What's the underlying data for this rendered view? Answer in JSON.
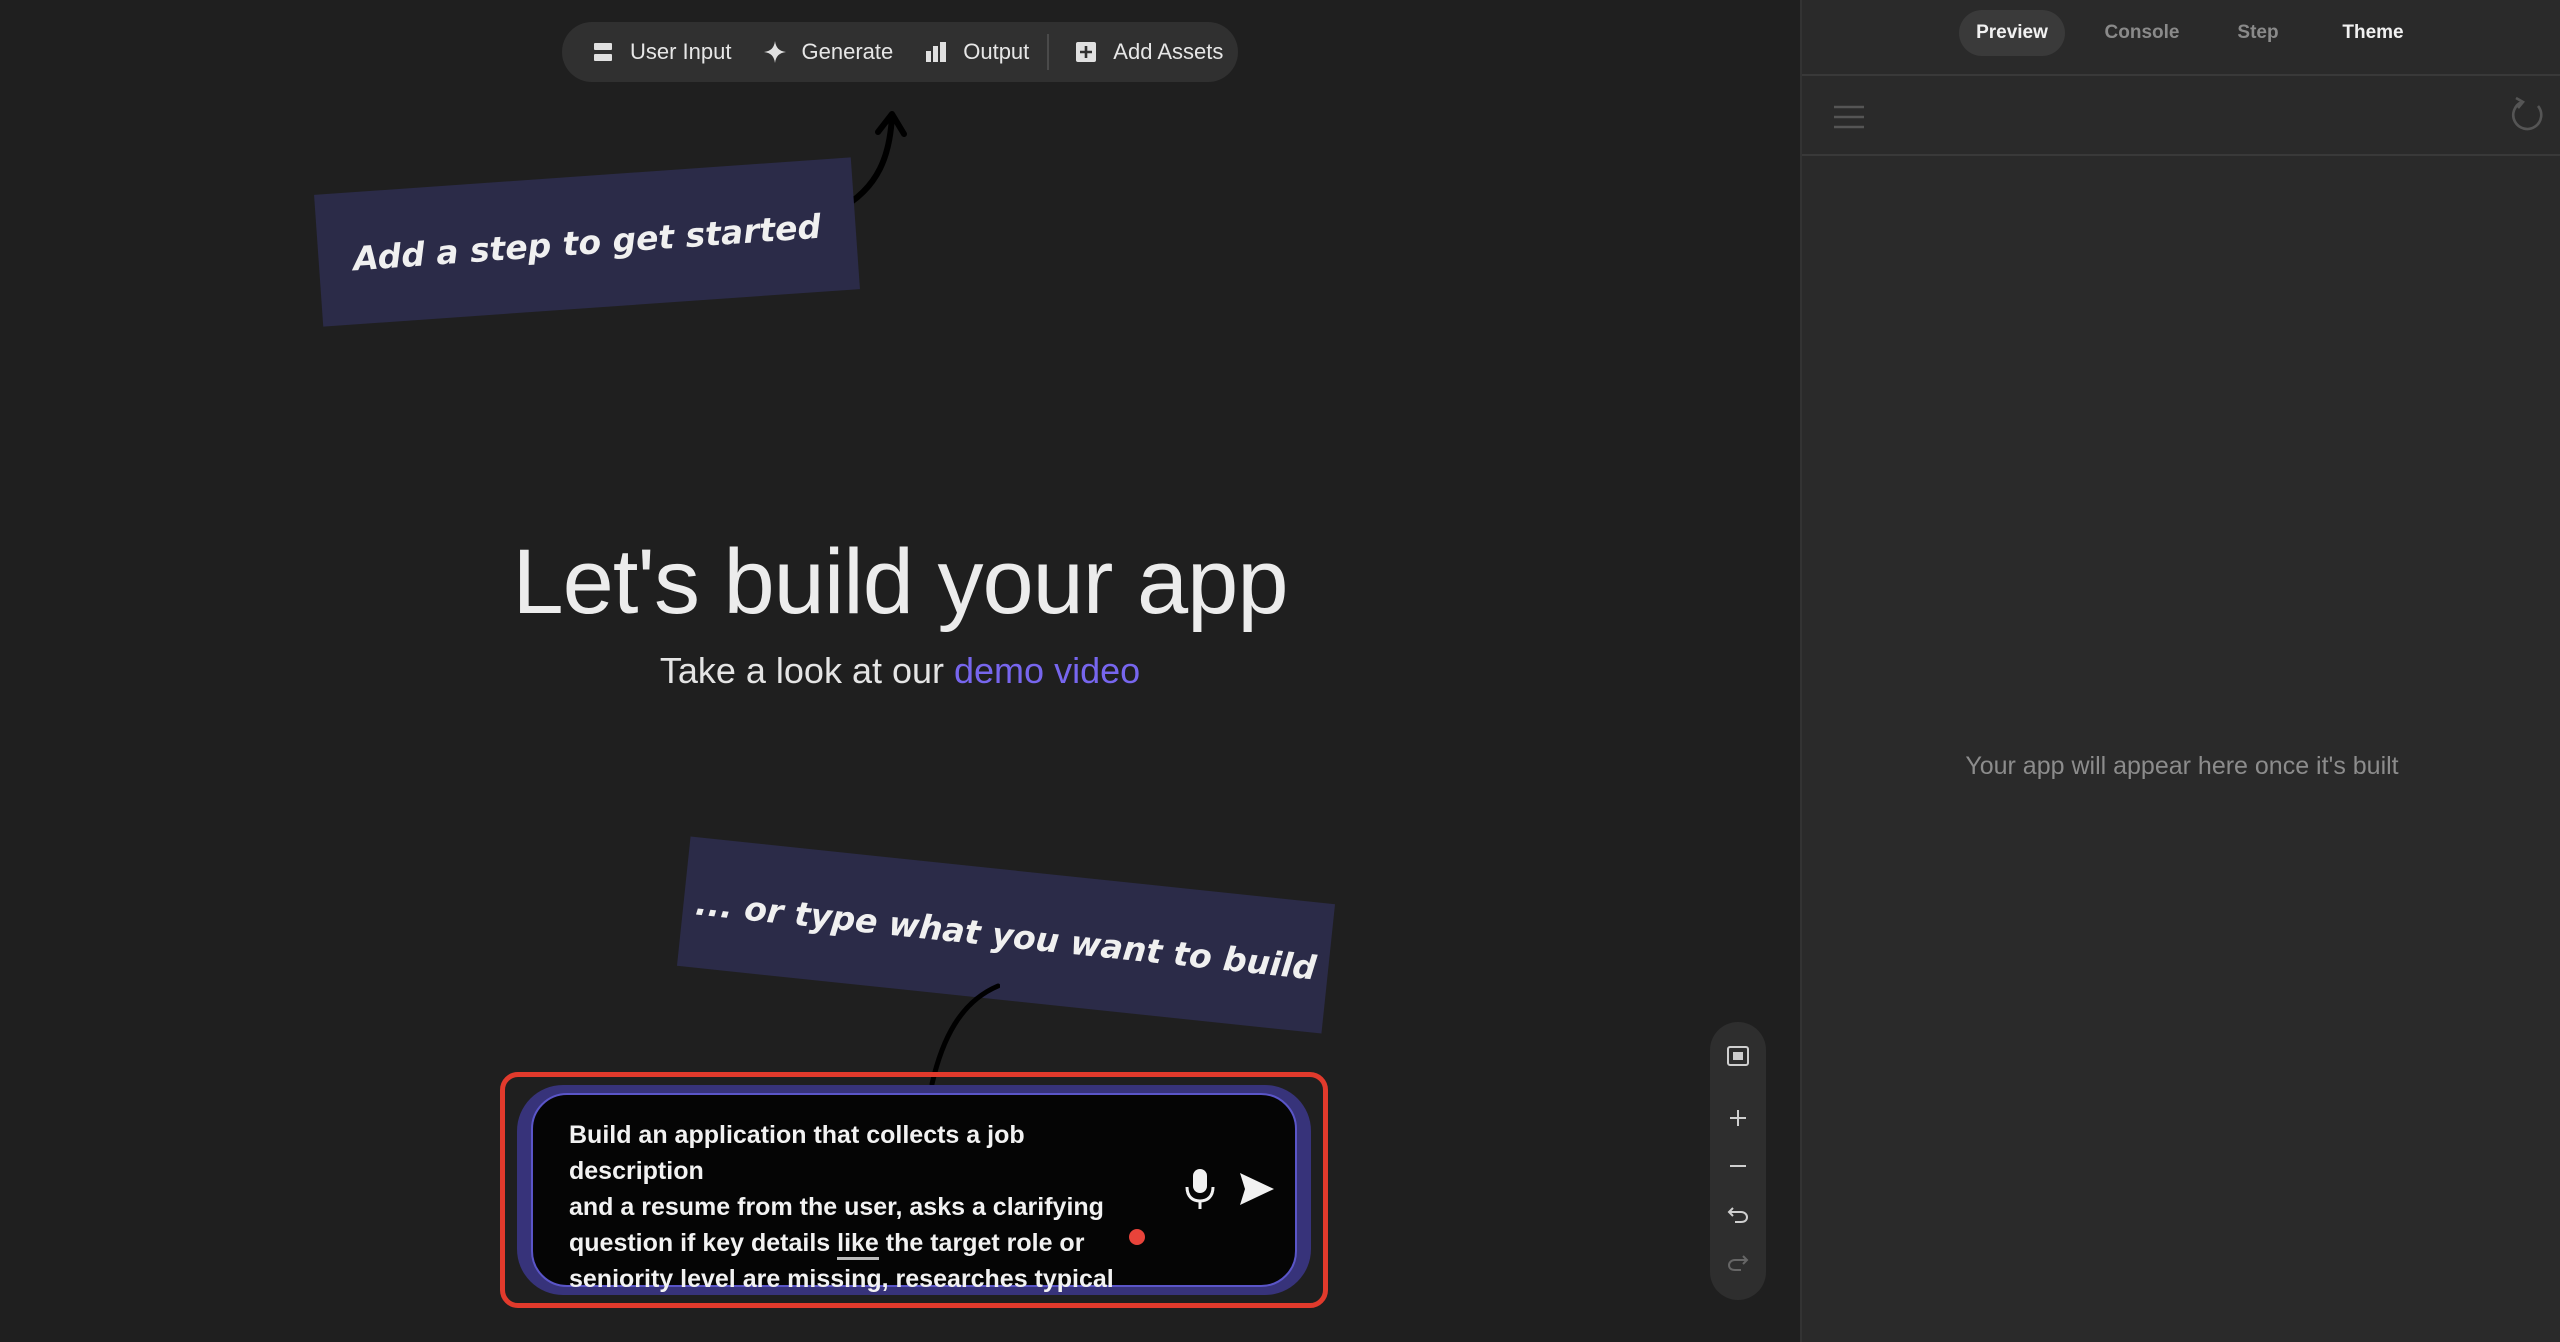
{
  "toolbar": {
    "user_input": "User Input",
    "generate": "Generate",
    "output": "Output",
    "add_assets": "Add Assets"
  },
  "notes": {
    "add_step": "Add a step to get started",
    "type_hint": "... or type what you want to build"
  },
  "hero": {
    "title": "Let's build your app",
    "subtitle_prefix": "Take a look at our ",
    "subtitle_link": "demo video"
  },
  "prompt": {
    "line1": "Build an application that collects a job description",
    "line2": "and a resume from the user, asks a clarifying",
    "line3_a": "question if key details ",
    "line3_u": "like",
    "line3_b": " the target role or",
    "line4": "seniority level are missing, researches typical"
  },
  "zoom_controls": [
    "fit-to-screen-icon",
    "zoom-in-icon",
    "zoom-out-icon",
    "undo-icon",
    "redo-icon"
  ],
  "panel": {
    "tabs": [
      "Preview",
      "Console",
      "Step",
      "Theme"
    ],
    "active_tab": "Preview",
    "placeholder": "Your app will appear here once it's built"
  },
  "colors": {
    "accent": "#7766ee",
    "highlight": "#e13a2c",
    "note_bg": "#2b2b48",
    "prompt_glow": "#37337a"
  }
}
